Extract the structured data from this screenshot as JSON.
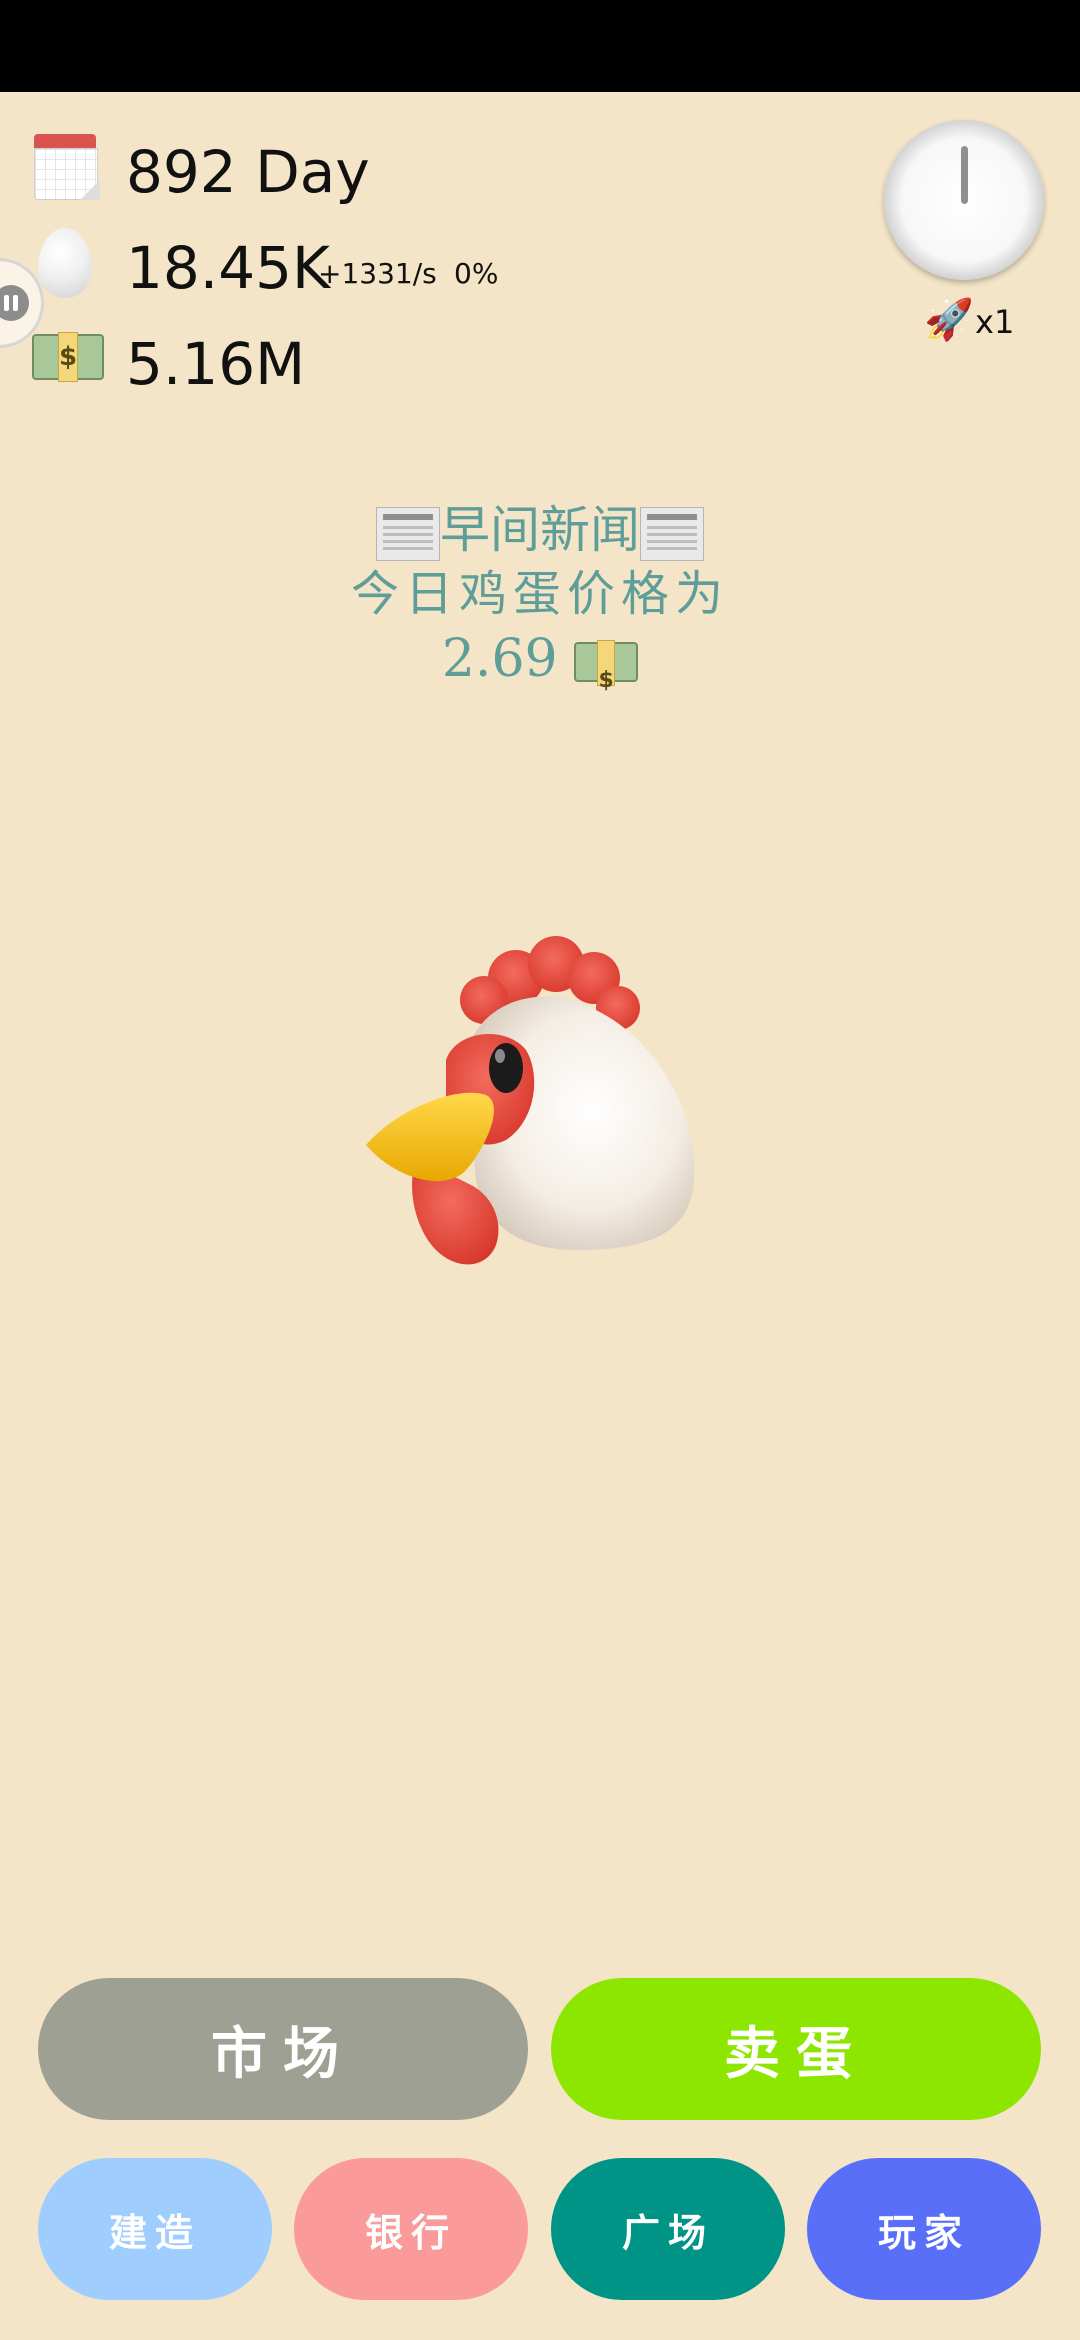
{
  "stats": {
    "day": "892 Day",
    "eggs": "18.45K",
    "egg_rate": "+1331/s",
    "egg_percent": "0%",
    "money": "5.16M"
  },
  "speed": {
    "multiplier": "x1"
  },
  "news": {
    "headline": "早间新闻",
    "text": "今日鸡蛋价格为",
    "price": "2.69"
  },
  "buttons": {
    "market": "市场",
    "sell_eggs": "卖蛋",
    "build": "建造",
    "bank": "银行",
    "plaza": "广场",
    "player": "玩家"
  },
  "colors": {
    "background": "#f4e5c8",
    "market": "#9da092",
    "sell_eggs": "#8de600",
    "build": "#9fcdfd",
    "bank": "#fa9a9a",
    "plaza": "#009486",
    "player": "#5a6ff8",
    "news_text": "#5f9e98"
  },
  "icons": [
    "calendar-icon",
    "egg-icon",
    "money-icon",
    "pause-icon",
    "clock-icon",
    "rocket-icon",
    "newspaper-icon",
    "chicken-icon"
  ]
}
